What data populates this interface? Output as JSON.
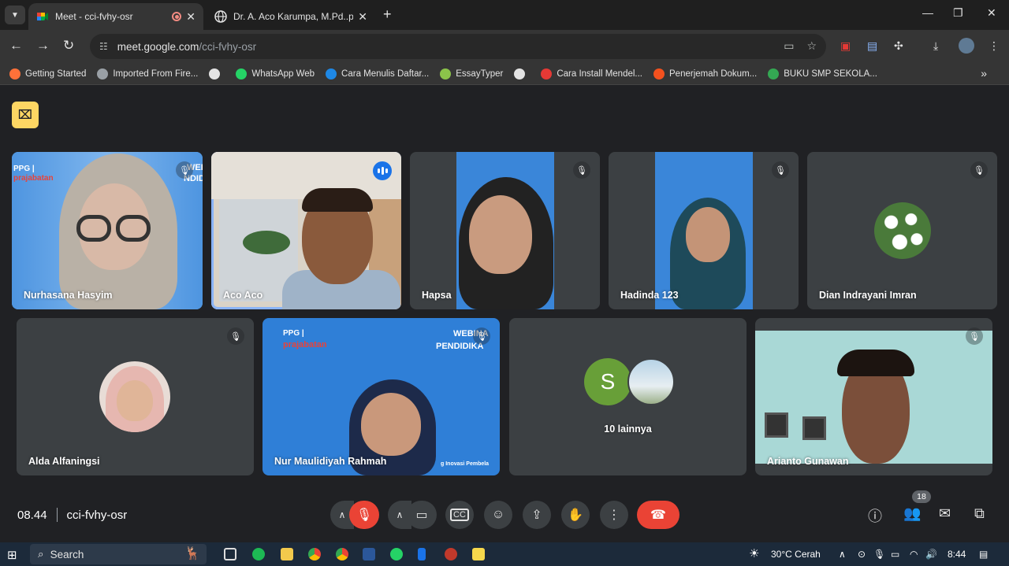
{
  "browser": {
    "tabs": [
      {
        "title": "Meet - cci-fvhy-osr",
        "active": true
      },
      {
        "title": "Dr. A. Aco Karumpa, M.Pd..pdf",
        "active": false
      }
    ],
    "url_host": "meet.google.com",
    "url_path": "/cci-fvhy-osr",
    "bookmarks": [
      {
        "label": "Getting Started",
        "color": "#ff7139"
      },
      {
        "label": "Imported From Fire...",
        "color": "#9aa0a6"
      },
      {
        "label": "",
        "color": "#e3e3e3"
      },
      {
        "label": "WhatsApp Web",
        "color": "#25d366"
      },
      {
        "label": "Cara Menulis Daftar...",
        "color": "#1e88e5"
      },
      {
        "label": "EssayTyper",
        "color": "#8bc34a"
      },
      {
        "label": "",
        "color": "#e3e3e3"
      },
      {
        "label": "Cara Install Mendel...",
        "color": "#e53935"
      },
      {
        "label": "Penerjemah Dokum...",
        "color": "#f4511e"
      },
      {
        "label": "BUKU SMP SEKOLA...",
        "color": "#34a853"
      }
    ]
  },
  "participants": [
    {
      "name": "Nurhasana Hasyim"
    },
    {
      "name": "Aco Aco"
    },
    {
      "name": "Hapsa"
    },
    {
      "name": "Hadinda 123"
    },
    {
      "name": "Dian Indrayani Imran"
    },
    {
      "name": "Alda Alfaningsi"
    },
    {
      "name": "Nur Maulidiyah Rahmah"
    },
    {
      "name": "10 lainnya",
      "initial": "S"
    },
    {
      "name": "Arianto Gunawan"
    }
  ],
  "backgrounds": {
    "logo_top": "PPG |",
    "logo_bottom": "prajabatan",
    "web_a": "WEB",
    "web_b": "NDID",
    "web_c": "WEBINA",
    "web_d": "PENDIDIKA",
    "inovasi": "g Inovasi Pembela"
  },
  "meetbar": {
    "time": "08.44",
    "code": "cci-fvhy-osr",
    "people_count": "18"
  },
  "taskbar": {
    "search": "Search",
    "weather": "30°C  Cerah",
    "time": "8:44"
  }
}
